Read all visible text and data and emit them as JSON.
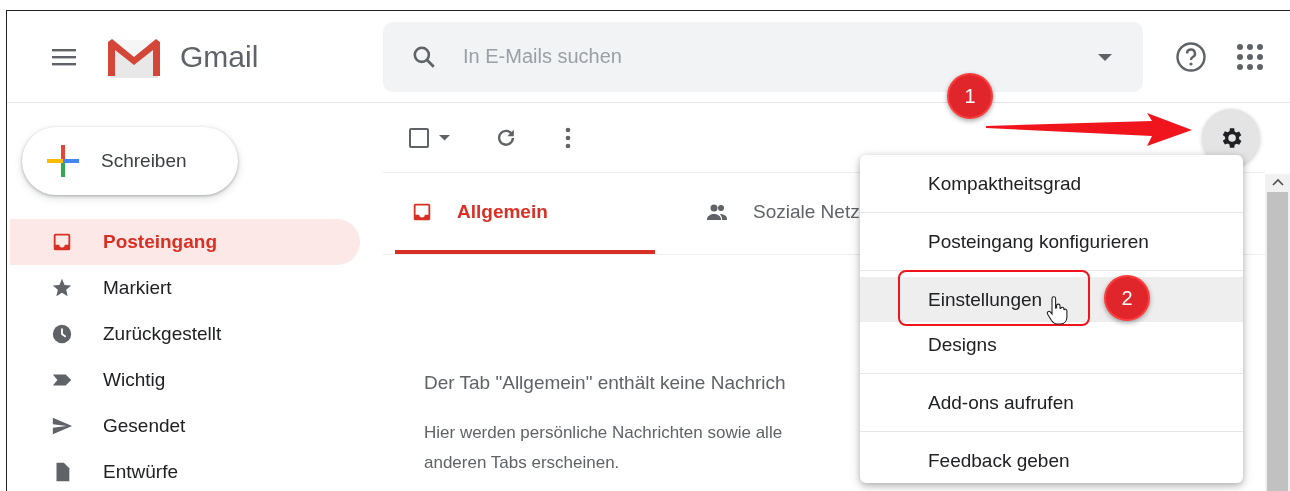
{
  "header": {
    "logo_text": "Gmail",
    "search": {
      "placeholder": "In E-Mails suchen"
    }
  },
  "compose": {
    "label": "Schreiben"
  },
  "nav": [
    {
      "label": "Posteingang",
      "kind": "inbox",
      "selected": true
    },
    {
      "label": "Markiert",
      "kind": "star",
      "selected": false
    },
    {
      "label": "Zurückgestellt",
      "kind": "clock",
      "selected": false
    },
    {
      "label": "Wichtig",
      "kind": "label",
      "selected": false
    },
    {
      "label": "Gesendet",
      "kind": "send",
      "selected": false
    },
    {
      "label": "Entwürfe",
      "kind": "draft",
      "selected": false
    }
  ],
  "toolbar": {
    "select_all": {
      "checked": false
    }
  },
  "tabs": [
    {
      "label": "Allgemein",
      "kind": "inbox",
      "selected": true
    },
    {
      "label": "Soziale Netz",
      "kind": "people",
      "selected": false
    }
  ],
  "empty_state": {
    "title": "Der Tab \"Allgemein\" enthält keine Nachrich",
    "body_lines": [
      "Hier werden persönliche Nachrichten sowie alle",
      "anderen Tabs erscheinen."
    ]
  },
  "settings_menu": {
    "sections": [
      [
        {
          "label": "Kompaktheitsgrad",
          "highlighted": false
        }
      ],
      [
        {
          "label": "Posteingang konfigurieren",
          "highlighted": false
        }
      ],
      [
        {
          "label": "Einstellungen",
          "highlighted": true
        },
        {
          "label": "Designs",
          "highlighted": false
        }
      ],
      [
        {
          "label": "Add-ons aufrufen",
          "highlighted": false
        }
      ],
      [
        {
          "label": "Feedback geben",
          "highlighted": false
        }
      ]
    ]
  },
  "annotations": [
    {
      "kind": "badge",
      "label": "1"
    },
    {
      "kind": "arrow"
    },
    {
      "kind": "frame"
    },
    {
      "kind": "badge",
      "label": "2"
    },
    {
      "kind": "cursor"
    }
  ]
}
